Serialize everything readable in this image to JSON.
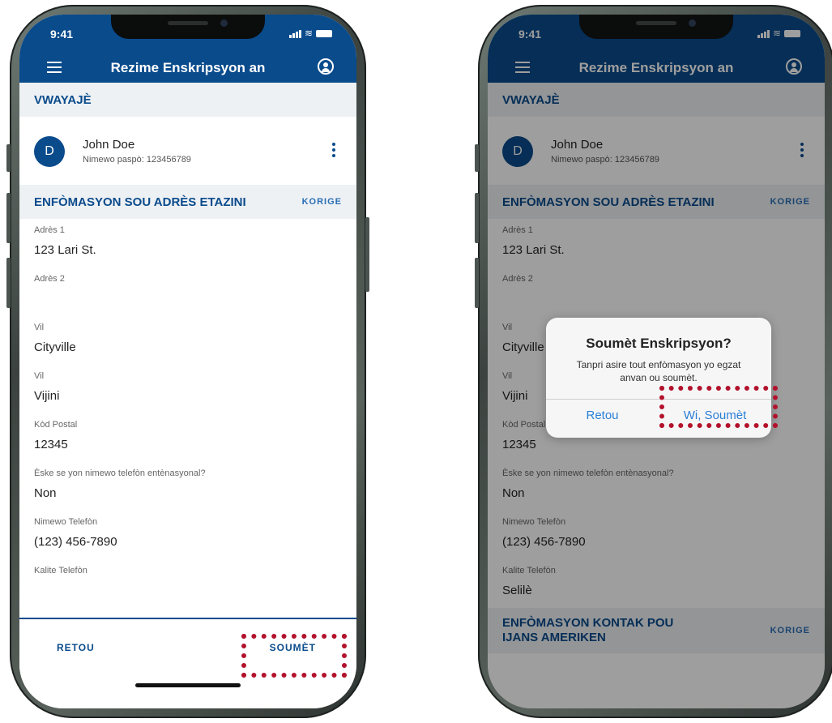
{
  "status_bar": {
    "time": "9:41"
  },
  "app_bar": {
    "title": "Rezime Enskripsyon an"
  },
  "traveler_section": {
    "title": "VWAYAJÈ",
    "avatar_initial": "D",
    "name": "John Doe",
    "passport": "Nimewo paspò: 123456789"
  },
  "address_section": {
    "title": "ENFÒMASYON SOU ADRÈS ETAZINI",
    "edit_label": "KORIGE"
  },
  "fields": [
    {
      "label": "Adrès 1",
      "value": "123 Lari St."
    },
    {
      "label": "Adrès 2",
      "value": ""
    },
    {
      "label": "Vil",
      "value": "Cityville"
    },
    {
      "label": "Vil",
      "value": "Vijini"
    },
    {
      "label": "Kòd Postal",
      "value": "12345"
    },
    {
      "label": "Èske se yon nimewo telefòn entènasyonal?",
      "value": "Non"
    },
    {
      "label": "Nimewo Telefòn",
      "value": "(123) 456-7890"
    },
    {
      "label": "Kalite Telefòn",
      "value": "Selilè"
    }
  ],
  "contact_section": {
    "title": "ENFÒMASYON KONTAK POU IJANS AMERIKEN",
    "edit_label": "KORIGE"
  },
  "bottom_bar": {
    "back_label": "RETOU",
    "submit_label": "SOUMÈT"
  },
  "dialog": {
    "title": "Soumèt Enskripsyon?",
    "message": "Tanpri asire tout enfòmasyon yo egzat anvan ou soumèt.",
    "cancel_label": "Retou",
    "confirm_label": "Wi, Soumèt"
  },
  "colors": {
    "brand": "#0a4b8c",
    "highlight": "#b3122c",
    "dialog_action": "#2a7fd6"
  }
}
